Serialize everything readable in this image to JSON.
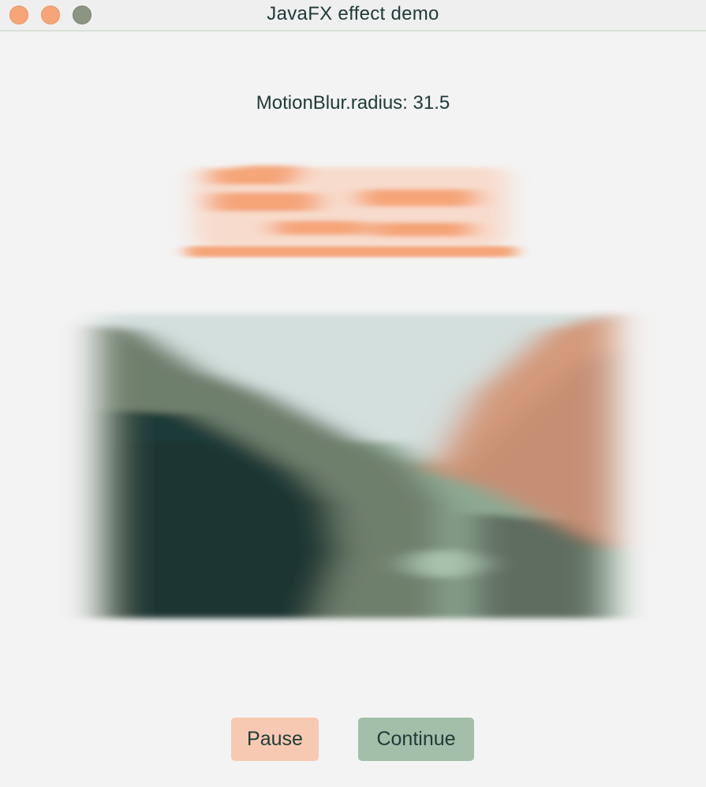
{
  "window": {
    "title": "JavaFX effect demo"
  },
  "effect": {
    "label": "MotionBlur.radius: 31.5"
  },
  "buttons": {
    "pause": "Pause",
    "continue": "Continue"
  },
  "colors": {
    "accent_orange": "#f5a578",
    "dark_green": "#1e3a38",
    "sage": "#a3bea9",
    "peach": "#f7c9b3",
    "background": "#f3f3f3"
  }
}
